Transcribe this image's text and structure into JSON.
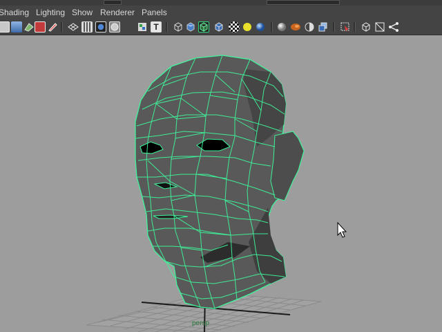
{
  "menubar": {
    "items": [
      {
        "label": "Shading"
      },
      {
        "label": "Lighting"
      },
      {
        "label": "Show"
      },
      {
        "label": "Renderer"
      },
      {
        "label": "Panels"
      }
    ]
  },
  "toolbar": {
    "tools": [
      {
        "icon": "select-camera-icon"
      },
      {
        "icon": "camera-attributes-icon"
      },
      {
        "icon": "bookmark-icon"
      },
      {
        "icon": "image-plane-icon"
      },
      {
        "icon": "wireframe-icon"
      },
      {
        "icon": "grid-toggle-icon"
      },
      {
        "icon": "film-gate-icon"
      },
      {
        "icon": "resolution-gate-icon"
      },
      {
        "icon": "gate-mask-icon"
      },
      {
        "icon": "safe-title-icon"
      },
      {
        "icon": "wireframe-shading-icon"
      },
      {
        "icon": "smooth-shading-icon"
      },
      {
        "icon": "wireframe-on-shaded-icon"
      },
      {
        "icon": "flat-shading-icon"
      },
      {
        "icon": "textured-icon"
      },
      {
        "icon": "use-lights-icon"
      },
      {
        "icon": "shadows-icon"
      },
      {
        "icon": "high-quality-icon"
      },
      {
        "icon": "screen-space-ao-icon"
      },
      {
        "icon": "motion-blur-icon"
      },
      {
        "icon": "anti-aliasing-icon"
      },
      {
        "icon": "isolate-select-icon"
      },
      {
        "icon": "xray-icon"
      },
      {
        "icon": "xray-joints-icon"
      },
      {
        "icon": "component-xray-icon"
      }
    ],
    "accent": "#2fd67c"
  },
  "viewport": {
    "camera_label": "persp",
    "background_color": "#9d9d9d",
    "wire_color": "#3df59a",
    "mesh_color": "#5b5b5b"
  }
}
